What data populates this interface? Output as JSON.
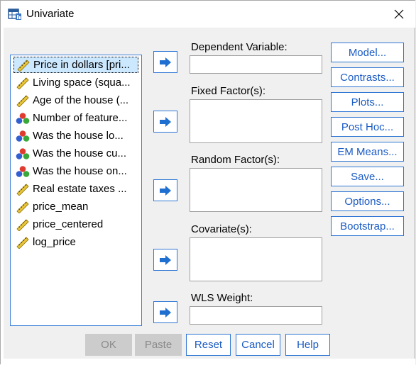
{
  "window": {
    "title": "Univariate",
    "close_glyph": "✕"
  },
  "variables": [
    {
      "label": "Price in dollars [pri...",
      "icon": "scale-ruler-icon",
      "selected": true
    },
    {
      "label": "Living space (squa...",
      "icon": "scale-ruler-icon"
    },
    {
      "label": "Age of the house (...",
      "icon": "scale-ruler-icon"
    },
    {
      "label": "Number of feature...",
      "icon": "nominal-balls-icon"
    },
    {
      "label": "Was the house lo...",
      "icon": "nominal-balls-icon"
    },
    {
      "label": "Was the house cu...",
      "icon": "nominal-balls-icon"
    },
    {
      "label": "Was the house on...",
      "icon": "nominal-balls-icon"
    },
    {
      "label": "Real estate taxes ...",
      "icon": "scale-ruler-icon"
    },
    {
      "label": "price_mean",
      "icon": "scale-ruler-icon"
    },
    {
      "label": "price_centered",
      "icon": "scale-ruler-icon"
    },
    {
      "label": "log_price",
      "icon": "scale-ruler-icon"
    }
  ],
  "fields": {
    "dependent": {
      "label": "Dependent Variable:",
      "value": ""
    },
    "fixed": {
      "label": "Fixed Factor(s):",
      "value": ""
    },
    "random": {
      "label": "Random Factor(s):",
      "value": ""
    },
    "covariate": {
      "label": "Covariate(s):",
      "value": ""
    },
    "wls": {
      "label": "WLS Weight:",
      "value": ""
    }
  },
  "side_buttons": {
    "model": "Model...",
    "contrasts": "Contrasts...",
    "plots": "Plots...",
    "posthoc": "Post Hoc...",
    "emmeans": "EM Means...",
    "save": "Save...",
    "options": "Options...",
    "bootstrap": "Bootstrap..."
  },
  "bottom_buttons": {
    "ok": {
      "label": "OK",
      "enabled": false
    },
    "paste": {
      "label": "Paste",
      "enabled": false
    },
    "reset": {
      "label": "Reset",
      "enabled": true
    },
    "cancel": {
      "label": "Cancel",
      "enabled": true
    },
    "help": {
      "label": "Help",
      "enabled": true
    }
  },
  "colors": {
    "accent": "#2f76d4",
    "link_text": "#1a5bc4",
    "selected_bg": "#cce8ff",
    "disabled_bg": "#cccccc"
  }
}
